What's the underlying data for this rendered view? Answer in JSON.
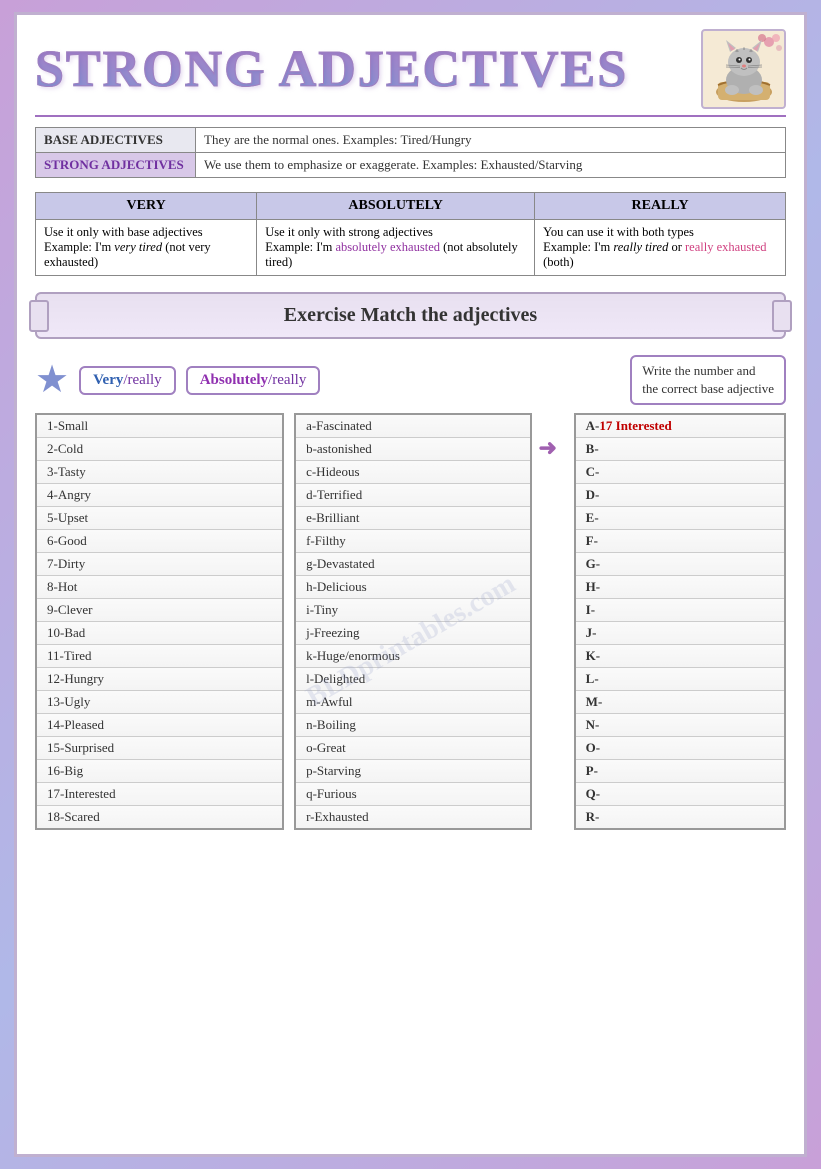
{
  "title": "STRONG ADJECTIVES",
  "cat_emoji": "🐱",
  "purple_line": true,
  "definitions": [
    {
      "label": "BASE ADJECTIVES",
      "style": "base",
      "text": "They are the normal ones. Examples: Tired/Hungry"
    },
    {
      "label": "STRONG ADJECTIVES",
      "style": "strong",
      "text": "We use them to emphasize or exaggerate. Examples: Exhausted/Starving"
    }
  ],
  "adverbs": [
    {
      "header": "VERY",
      "text": "Use it only with base adjectives",
      "example_plain": "Example: I'm very tired",
      "example_note": "(not very exhausted)",
      "highlight": ""
    },
    {
      "header": "ABSOLUTELY",
      "text": "Use it only with strong adjectives",
      "example_before": "Example: I'm absolutely ",
      "example_highlight": "exhausted",
      "example_after": " (not absolutely tired)",
      "highlight_color": "purple"
    },
    {
      "header": "REALLY",
      "text": "You can use it with both types",
      "example_before": "Example: I'm really tired or really ",
      "example_highlight": "exhausted",
      "example_after": " (both)",
      "highlight_color": "pink"
    }
  ],
  "exercise_label": "Exercise   Match the adjectives",
  "star": "★",
  "tag_very": "Very",
  "tag_really": "/really",
  "tag_absolutely": "Absolutely",
  "tag_really2": "/really",
  "write_instruction_line1": "Write the number and",
  "write_instruction_line2": "the correct base adjective",
  "base_list": [
    "1-Small",
    "2-Cold",
    "3-Tasty",
    "4-Angry",
    "5-Upset",
    "6-Good",
    "7-Dirty",
    "8-Hot",
    "9-Clever",
    "10-Bad",
    "11-Tired",
    "12-Hungry",
    "13-Ugly",
    "14-Pleased",
    "15-Surprised",
    "16-Big",
    "17-Interested",
    "18-Scared"
  ],
  "strong_list": [
    "a-Fascinated",
    "b-astonished",
    "c-Hideous",
    "d-Terrified",
    "e-Brilliant",
    "f-Filthy",
    "g-Devastated",
    "h-Delicious",
    "i-Tiny",
    "j-Freezing",
    "k-Huge/enormous",
    "l-Delighted",
    "m-Awful",
    "n-Boiling",
    "o-Great",
    "p-Starving",
    "q-Furious",
    "r-Exhausted"
  ],
  "answers": [
    {
      "letter": "A",
      "num": "17",
      "word": "Interested",
      "filled": true
    },
    {
      "letter": "B",
      "num": "",
      "word": "",
      "filled": false
    },
    {
      "letter": "C",
      "num": "",
      "word": "",
      "filled": false
    },
    {
      "letter": "D",
      "num": "",
      "word": "",
      "filled": false
    },
    {
      "letter": "E",
      "num": "",
      "word": "",
      "filled": false
    },
    {
      "letter": "F",
      "num": "",
      "word": "",
      "filled": false
    },
    {
      "letter": "G",
      "num": "",
      "word": "",
      "filled": false
    },
    {
      "letter": "H",
      "num": "",
      "word": "",
      "filled": false
    },
    {
      "letter": "I",
      "num": "",
      "word": "",
      "filled": false
    },
    {
      "letter": "J",
      "num": "",
      "word": "",
      "filled": false
    },
    {
      "letter": "K",
      "num": "",
      "word": "",
      "filled": false
    },
    {
      "letter": "L",
      "num": "",
      "word": "",
      "filled": false
    },
    {
      "letter": "M",
      "num": "",
      "word": "",
      "filled": false
    },
    {
      "letter": "N",
      "num": "",
      "word": "",
      "filled": false
    },
    {
      "letter": "O",
      "num": "",
      "word": "",
      "filled": false
    },
    {
      "letter": "P",
      "num": "",
      "word": "",
      "filled": false
    },
    {
      "letter": "Q",
      "num": "",
      "word": "",
      "filled": false
    },
    {
      "letter": "R",
      "num": "",
      "word": "",
      "filled": false
    }
  ],
  "watermark": "BLDprintables.com"
}
